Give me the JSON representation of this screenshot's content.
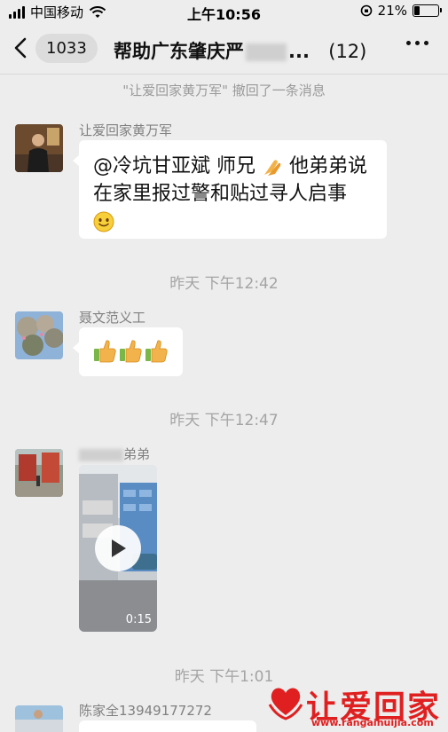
{
  "status_bar": {
    "carrier": "中国移动",
    "time": "上午10:56",
    "battery": "21%",
    "battery_level": 0.21
  },
  "header": {
    "unread_count": "1033",
    "title_prefix": "帮助广东肇庆严",
    "title_suffix": "...",
    "member_count": "(12)"
  },
  "messages": {
    "recall_notice": "\"让爱回家黄万军\" 撤回了一条消息",
    "msg1": {
      "sender": "让爱回家黄万军",
      "line1": "@冷坑甘亚斌 师兄",
      "line1b": "他弟弟说",
      "line2": "在家里报过警和贴过寻人启事",
      "emoji_inline": "pray-emoji",
      "emoji_end": "smile-emoji"
    },
    "time1": "昨天 下午12:42",
    "msg2": {
      "sender": "聂文范义工",
      "emojis": [
        "thumbs-up-emoji",
        "thumbs-up-emoji",
        "thumbs-up-emoji"
      ]
    },
    "time2": "昨天 下午12:47",
    "msg3": {
      "sender_suffix": "弟弟",
      "video_duration": "0:15"
    },
    "time3": "昨天 下午1:01",
    "msg4": {
      "sender": "陈家全13949177272"
    }
  },
  "watermark": {
    "brand": "让爱回家",
    "url": "www.rangaihuijia.com"
  },
  "colors": {
    "background": "#ededed",
    "bubble": "#ffffff",
    "watermark": "#e02020"
  }
}
